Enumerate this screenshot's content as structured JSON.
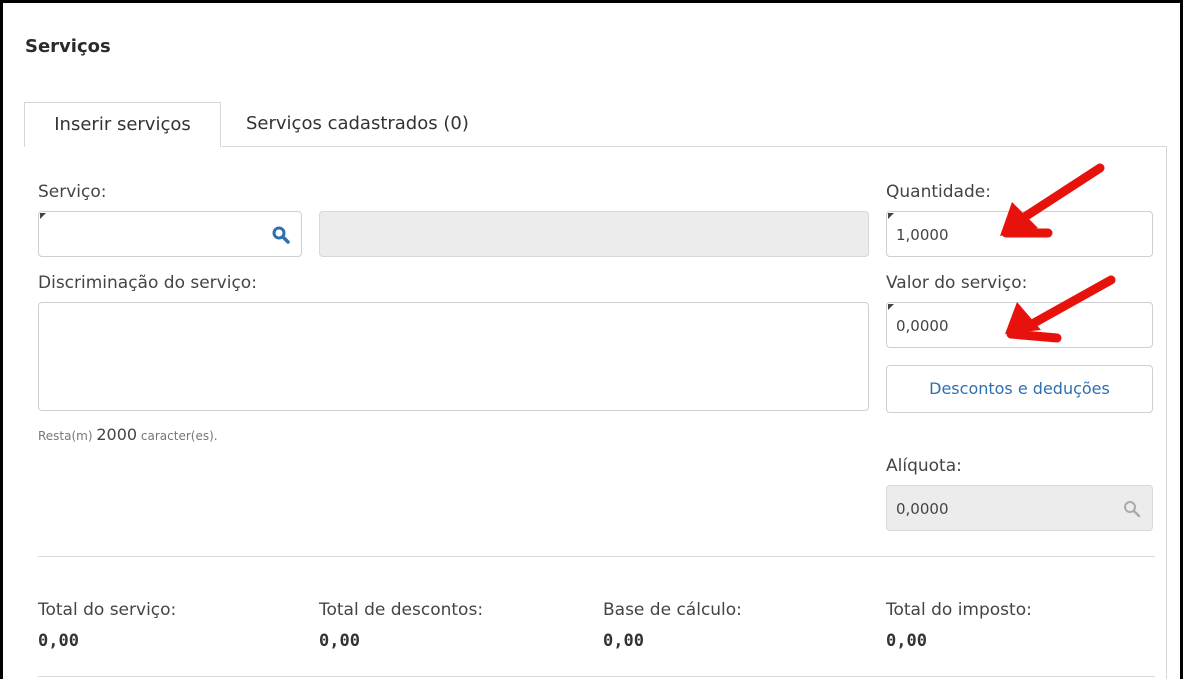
{
  "section_title": "Serviços",
  "tabs": [
    {
      "label": "Inserir serviços",
      "active": true
    },
    {
      "label": "Serviços cadastrados (0)",
      "active": false
    }
  ],
  "form": {
    "servico_label": "Serviço:",
    "servico_value": "",
    "servico_descricao": "",
    "discriminacao_label": "Discriminação do serviço:",
    "discriminacao_value": "",
    "remaining_prefix": "Resta(m)",
    "remaining_count": "2000",
    "remaining_suffix": "caracter(es).",
    "quantidade_label": "Quantidade:",
    "quantidade_value": "1,0000",
    "valor_label": "Valor do serviço:",
    "valor_value": "0,0000",
    "descontos_button": "Descontos e deduções",
    "aliquota_label": "Alíquota:",
    "aliquota_value": "0,0000"
  },
  "totals": [
    {
      "label": "Total do serviço:",
      "value": "0,00"
    },
    {
      "label": "Total de descontos:",
      "value": "0,00"
    },
    {
      "label": "Base de cálculo:",
      "value": "0,00"
    },
    {
      "label": "Total do imposto:",
      "value": "0,00"
    }
  ],
  "colors": {
    "accent": "#2f6fb0",
    "annotation_arrow": "#e8120c",
    "search_icon": "#2f6fb0"
  },
  "icons": {
    "servico_search": "search-icon",
    "aliquota_search": "search-icon"
  }
}
